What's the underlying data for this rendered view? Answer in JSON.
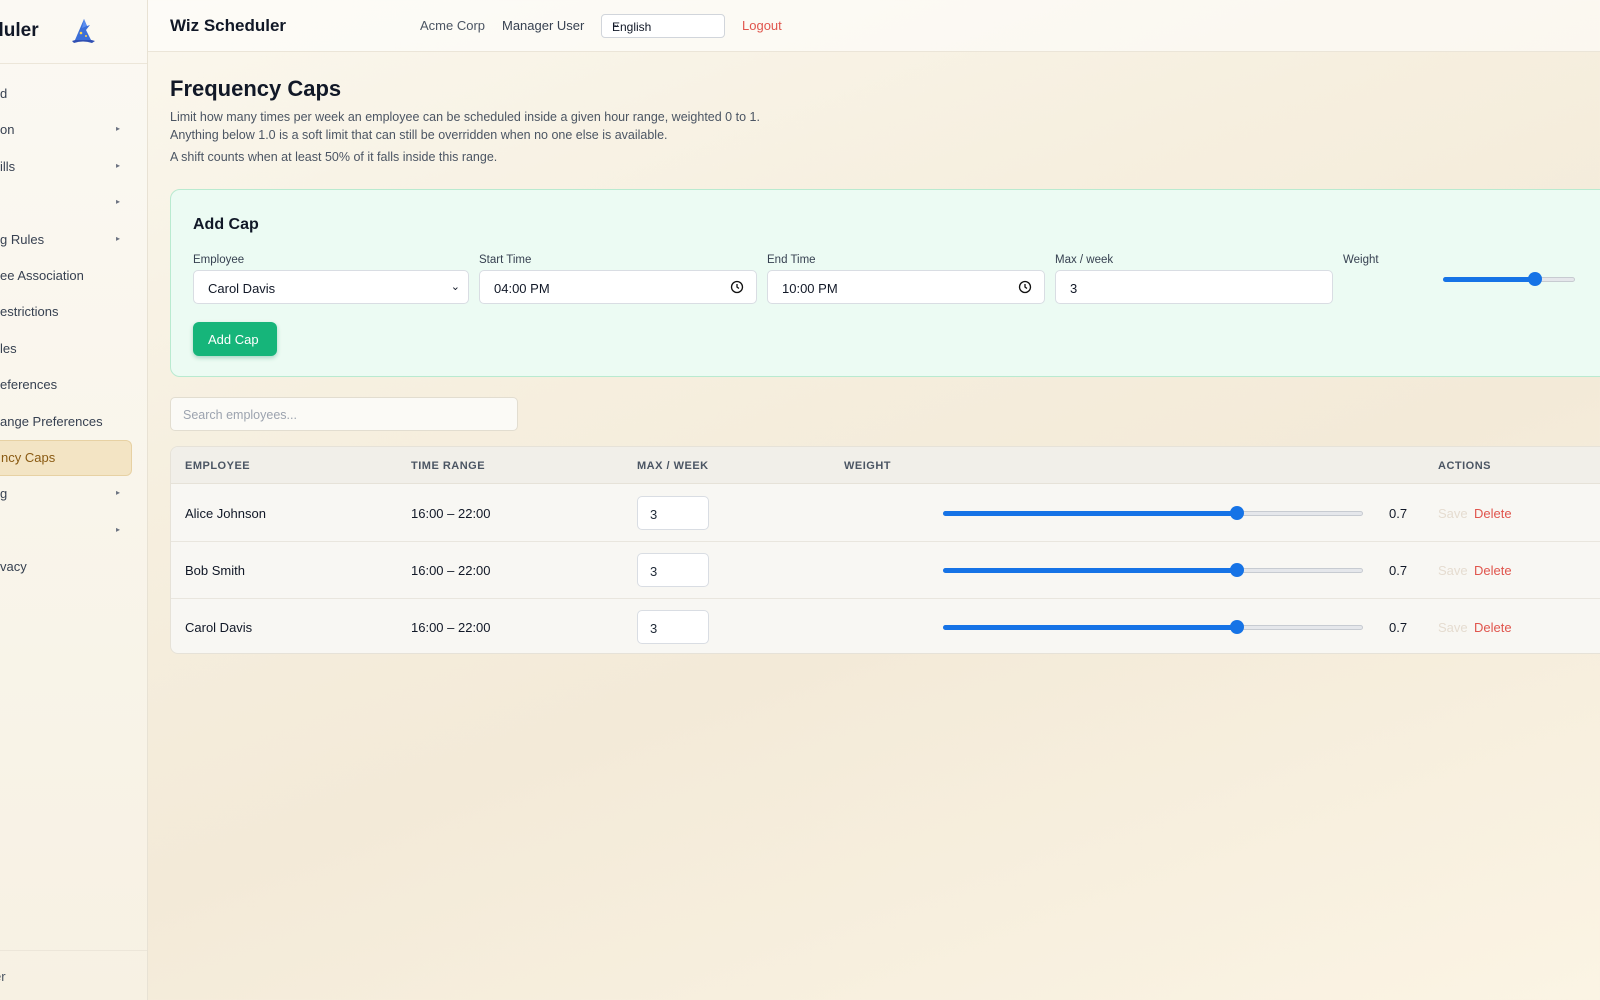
{
  "sidebar": {
    "brand": "Wiz Scheduler",
    "items": [
      {
        "label": "Dashboard",
        "visible": "d",
        "arrow": false
      },
      {
        "label": "Organization",
        "visible": "on",
        "arrow": true
      },
      {
        "label": "Employee Skills",
        "visible": "ills",
        "arrow": true
      },
      {
        "label": "",
        "visible": "",
        "arrow": true
      },
      {
        "label": "Scheduling Rules",
        "visible": "g Rules",
        "arrow": true
      },
      {
        "label": "Employee Association",
        "visible": "ee Association",
        "arrow": false
      },
      {
        "label": "Restrictions",
        "visible": "estrictions",
        "arrow": false
      },
      {
        "label": "Rules",
        "visible": "les",
        "arrow": false
      },
      {
        "label": "Preferences",
        "visible": "eferences",
        "arrow": false
      },
      {
        "label": "Range Preferences",
        "visible": "ange Preferences",
        "arrow": false
      },
      {
        "label": "Frequency Caps",
        "visible": "ncy Caps",
        "arrow": false,
        "active": true
      },
      {
        "label": "",
        "visible": "g",
        "arrow": true
      },
      {
        "label": "",
        "visible": "",
        "arrow": true
      },
      {
        "label": "Privacy",
        "visible": "vacy",
        "arrow": false
      }
    ],
    "footer": "er"
  },
  "topbar": {
    "title": "Wiz Scheduler",
    "org": "Acme Corp",
    "user": "Manager User",
    "language": "English",
    "logout": "Logout"
  },
  "page": {
    "title": "Frequency Caps",
    "description": "Limit how many times per week an employee can be scheduled inside a given hour range, weighted 0 to 1. Anything below 1.0 is a soft limit that can still be overridden when no one else is available.",
    "note": "A shift counts when at least 50% of it falls inside this range."
  },
  "add_cap": {
    "title": "Add Cap",
    "employee_label": "Employee",
    "employee_value": "Carol Davis",
    "start_label": "Start Time",
    "start_value": "04:00 PM",
    "end_label": "End Time",
    "end_value": "10:00 PM",
    "max_label": "Max / week",
    "max_value": "3",
    "weight_label": "Weight",
    "weight_value": 0.7,
    "button": "Add Cap"
  },
  "search": {
    "placeholder": "Search employees..."
  },
  "table": {
    "headers": {
      "employee": "EMPLOYEE",
      "time_range": "TIME RANGE",
      "max_week": "MAX / WEEK",
      "weight": "WEIGHT",
      "actions": "ACTIONS"
    },
    "rows": [
      {
        "employee": "Alice Johnson",
        "time_range": "16:00 – 22:00",
        "max": "3",
        "weight": 0.7,
        "weight_text": "0.7",
        "save": "Save",
        "delete": "Delete"
      },
      {
        "employee": "Bob Smith",
        "time_range": "16:00 – 22:00",
        "max": "3",
        "weight": 0.7,
        "weight_text": "0.7",
        "save": "Save",
        "delete": "Delete"
      },
      {
        "employee": "Carol Davis",
        "time_range": "16:00 – 22:00",
        "max": "3",
        "weight": 0.7,
        "weight_text": "0.7",
        "save": "Save",
        "delete": "Delete"
      }
    ]
  },
  "colors": {
    "accent": "#1673e6",
    "primary_button": "#16b57a",
    "danger": "#e0554d",
    "active_nav": "#f3e4c4"
  }
}
